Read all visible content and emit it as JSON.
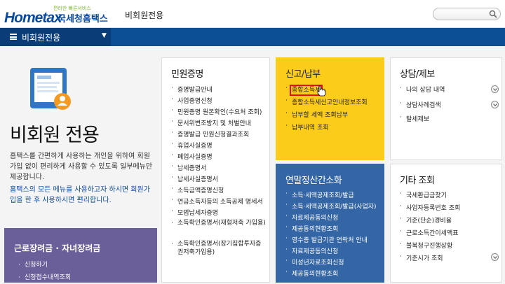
{
  "header": {
    "logo_text": "Hometax",
    "logo_tagline": "편리한 빠른서비스",
    "logo_org": "국세청홈택스",
    "page_heading": "비회원전용",
    "search_placeholder": ""
  },
  "nav": {
    "menu_label": "비회원전용"
  },
  "hero": {
    "title": "비회원 전용",
    "description": "홈택스를 간편하게 사용하는 개인을 위하여 회원가입 없이 편리하게 사용할 수 있도록 일부메뉴만 제공합니다.",
    "member_link": "홈택스의 모든 메뉴를 사용하고자 하시면 회원가입을 한 후 사용하시면 편리합니다."
  },
  "worker": {
    "title": "근로장려금 · 자녀장려금",
    "items": [
      "신청하기",
      "신청접수내역조회"
    ]
  },
  "civil": {
    "title": "민원증명",
    "items": [
      "증명발급안내",
      "사업증명신청",
      "민원증명 원본확인(수요처 조회)",
      "문서위변조방지 및 처벌안내",
      "증명발급 민원신청결과조회",
      "휴업사실증명",
      "폐업사실증명",
      "납세증명서",
      "납세사실증명서",
      "소득금액증명신청",
      "연금소득자등의 소득공제 명세서",
      "모범납세자증명",
      "소득확인증명서(재형저축 가입용)",
      "소득확인증명서(장기집합투자증권저축가입용)"
    ]
  },
  "filing": {
    "title": "신고/납부",
    "items": [
      "종합소득세",
      "종합소득세신고안내정보조회",
      "납부할 세액 조회납부",
      "납부내역 조회"
    ]
  },
  "consult": {
    "title": "상담/제보",
    "items": [
      "나의 상담 내역",
      "상담사례검색",
      "탈세제보"
    ]
  },
  "yearend": {
    "title": "연말정산간소화",
    "items": [
      "소득·세액공제조회/발급",
      "소득·세액공제조회/발급(사업자)",
      "자료제공동의신청",
      "제공동의현황조회",
      "영수증 발급기관 연락처 안내",
      "자료제공동의신청",
      "미성년자료조회신청",
      "제공동의현황조회"
    ]
  },
  "etc": {
    "title": "기타 조회",
    "items": [
      "국세환급금찾기",
      "사업자등록번호 조회",
      "기준(단순)경비율",
      "근로소득간이세액표",
      "불복청구진행상황",
      "기준시가 조회"
    ]
  },
  "colors": {
    "brand_blue": "#0d4f95",
    "yellow": "#fccc1b",
    "section_blue": "#3466a6",
    "purple": "#6b5f99",
    "highlight_red": "#e01010"
  }
}
